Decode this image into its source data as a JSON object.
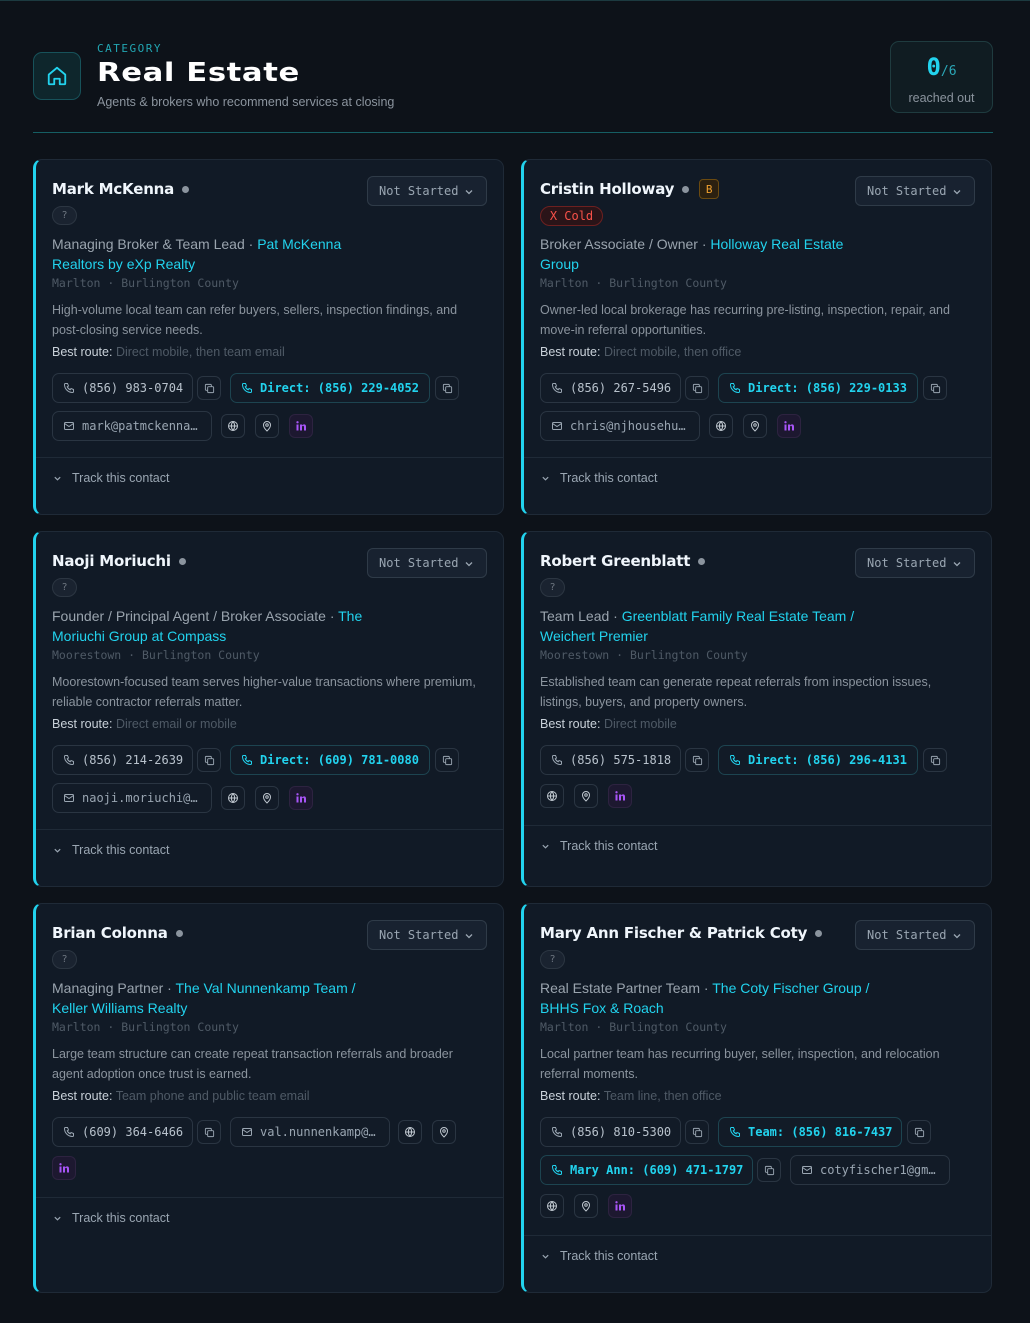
{
  "header": {
    "kicker": "CATEGORY",
    "title": "Real Estate",
    "subtitle": "Agents & brokers who recommend services at closing",
    "reach_count": "0",
    "reach_total": "/6",
    "reach_label": "reached out"
  },
  "accent_color": "#22d3ee",
  "track_label": "Track this contact",
  "best_route_label": "Best route:",
  "contacts": [
    {
      "name": "Mark McKenna",
      "status": "Not Started",
      "badge": "?",
      "role": "Managing Broker & Team Lead · ",
      "org": "Pat McKenna Realtors by eXp Realty",
      "location": "Marlton · Burlington County",
      "description": "High-volume local team can refer buyers, sellers, inspection findings, and post-closing service needs.",
      "best_route": "Direct mobile, then team email",
      "phone": "(856) 983-0704",
      "direct": "Direct: (856) 229-4052",
      "email": "mark@patmckenna…"
    },
    {
      "name": "Cristin Holloway",
      "tier": "B",
      "status": "Not Started",
      "temperature": "X Cold",
      "role": "Broker Associate / Owner · ",
      "org": "Holloway Real Estate Group",
      "location": "Marlton · Burlington County",
      "description": "Owner-led local brokerage has recurring pre-listing, inspection, repair, and move-in referral opportunities.",
      "best_route": "Direct mobile, then office",
      "phone": "(856) 267-5496",
      "direct": "Direct: (856) 229-0133",
      "email": "chris@njhousehu…"
    },
    {
      "name": "Naoji Moriuchi",
      "status": "Not Started",
      "badge": "?",
      "role": "Founder / Principal Agent / Broker Associate · ",
      "org": "The Moriuchi Group at Compass",
      "location": "Moorestown · Burlington County",
      "description": "Moorestown-focused team serves higher-value transactions where premium, reliable contractor referrals matter.",
      "best_route": "Direct email or mobile",
      "phone": "(856) 214-2639",
      "direct": "Direct: (609) 781-0080",
      "email": "naoji.moriuchi@…"
    },
    {
      "name": "Robert Greenblatt",
      "status": "Not Started",
      "badge": "?",
      "role": "Team Lead · ",
      "org": "Greenblatt Family Real Estate Team / Weichert Premier",
      "location": "Moorestown · Burlington County",
      "description": "Established team can generate repeat referrals from inspection issues, listings, buyers, and property owners.",
      "best_route": "Direct mobile",
      "phone": "(856) 575-1818",
      "direct": "Direct: (856) 296-4131"
    },
    {
      "name": "Brian Colonna",
      "status": "Not Started",
      "badge": "?",
      "role": "Managing Partner · ",
      "org": "The Val Nunnenkamp Team / Keller Williams Realty",
      "location": "Marlton · Burlington County",
      "description": "Large team structure can create repeat transaction referrals and broader agent adoption once trust is earned.",
      "best_route": "Team phone and public team email",
      "phone": "(609) 364-6466",
      "email": "val.nunnenkamp@…"
    },
    {
      "name": "Mary Ann Fischer & Patrick Coty",
      "status": "Not Started",
      "badge": "?",
      "role": "Real Estate Partner Team · ",
      "org": "The Coty Fischer Group / BHHS Fox & Roach",
      "location": "Marlton · Burlington County",
      "description": "Local partner team has recurring buyer, seller, inspection, and relocation referral moments.",
      "best_route": "Team line, then office",
      "phone": "(856) 810-5300",
      "team": "Team: (856) 816-7437",
      "maryann": "Mary Ann: (609) 471-1797",
      "email": "cotyfischer1@gm…"
    }
  ]
}
